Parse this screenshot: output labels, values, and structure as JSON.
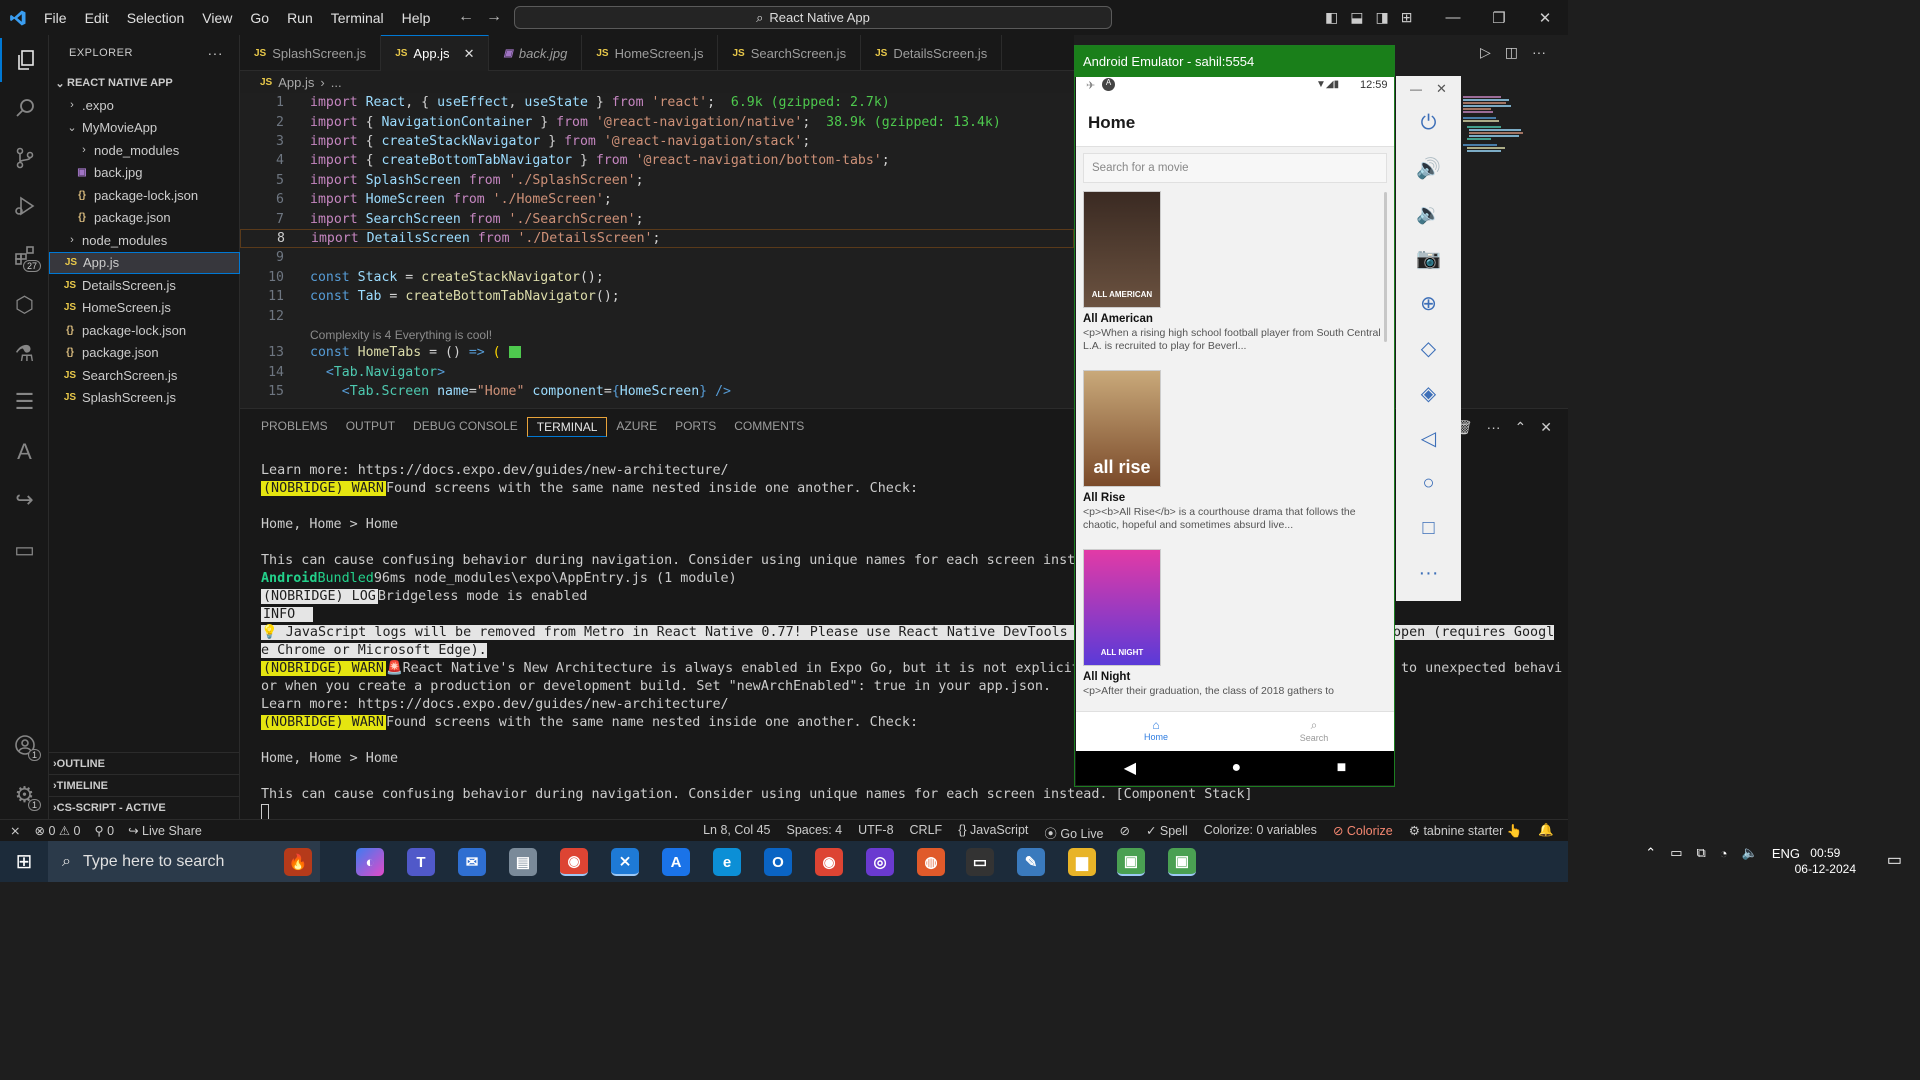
{
  "titlebar": {
    "logo": "⨯",
    "menu": [
      "File",
      "Edit",
      "Selection",
      "View",
      "Go",
      "Run",
      "Terminal",
      "Help"
    ],
    "search": "React Native App"
  },
  "activity_badges": {
    "extensions": "27",
    "accounts": "1",
    "settings": "1"
  },
  "sidebar": {
    "title": "EXPLORER",
    "project": "REACT NATIVE APP",
    "tree": [
      {
        "label": ".expo",
        "type": "folder",
        "indent": 1,
        "open": false
      },
      {
        "label": "MyMovieApp",
        "type": "folder",
        "indent": 1,
        "open": true
      },
      {
        "label": "node_modules",
        "type": "folder",
        "indent": 2,
        "open": false
      },
      {
        "label": "back.jpg",
        "type": "img",
        "indent": 2
      },
      {
        "label": "package-lock.json",
        "type": "json",
        "indent": 2
      },
      {
        "label": "package.json",
        "type": "json",
        "indent": 2
      },
      {
        "label": "node_modules",
        "type": "folder",
        "indent": 1,
        "open": false
      },
      {
        "label": "App.js",
        "type": "js",
        "indent": 1,
        "selected": true
      },
      {
        "label": "DetailsScreen.js",
        "type": "js",
        "indent": 1
      },
      {
        "label": "HomeScreen.js",
        "type": "js",
        "indent": 1
      },
      {
        "label": "package-lock.json",
        "type": "json",
        "indent": 1
      },
      {
        "label": "package.json",
        "type": "json",
        "indent": 1
      },
      {
        "label": "SearchScreen.js",
        "type": "js",
        "indent": 1
      },
      {
        "label": "SplashScreen.js",
        "type": "js",
        "indent": 1
      }
    ],
    "sections": [
      "OUTLINE",
      "TIMELINE",
      "CS-SCRIPT - ACTIVE"
    ]
  },
  "tabs": [
    {
      "label": "SplashScreen.js",
      "icon": "JS"
    },
    {
      "label": "App.js",
      "icon": "JS",
      "active": true
    },
    {
      "label": "back.jpg",
      "icon": "img"
    },
    {
      "label": "HomeScreen.js",
      "icon": "JS"
    },
    {
      "label": "SearchScreen.js",
      "icon": "JS"
    },
    {
      "label": "DetailsScreen.js",
      "icon": "JS"
    }
  ],
  "breadcrumb": {
    "file": "App.js",
    "rest": "..."
  },
  "code": {
    "l1_hint": "6.9k (gzipped: 2.7k)",
    "l2_hint": "38.9k (gzipped: 13.4k)",
    "codelens": "Complexity is 4 Everything is cool!"
  },
  "panel": {
    "tabs": [
      "PROBLEMS",
      "OUTPUT",
      "DEBUG CONSOLE",
      "TERMINAL",
      "AZURE",
      "PORTS",
      "COMMENTS"
    ],
    "active_tab": "TERMINAL"
  },
  "terminal": {
    "l1": "Learn more: https://docs.expo.dev/guides/new-architecture/",
    "warn_tag": "(NOBRIDGE) WARN",
    "log_tag": "(NOBRIDGE) LOG",
    "info_tag": "INFO",
    "found": "Found screens with the same name nested inside one another. Check:",
    "homes": "Home, Home > Home",
    "confusing_cut": "This can cause confusing behavior during navigation. Consider using unique names for each screen instead. [Comp",
    "confusing_full": "This can cause confusing behavior during navigation. Consider using unique names for each screen instead. [Component Stack]",
    "android": "Android",
    "bundled": "Bundled",
    "bundled_rest": "96ms node_modules\\expo\\AppEntry.js (1 module)",
    "bridgeless": "Bridgeless mode is enabled",
    "js_logs_a": "JavaScript logs will be removed from Metro in React Native 0.77! Please use React Native DevTools as your d",
    "js_logs_b": "open (requires Googl",
    "js_logs_c": "e Chrome or Microsoft Edge).",
    "newarch_a": "React Native's New Architecture is always enabled in Expo Go, but it is not explicitly ena",
    "newarch_b": "to unexpected behavi",
    "newarch_c": "or when you create a production or development build. Set \"newArchEnabled\": true in your app.json."
  },
  "statusbar": {
    "errors": "0",
    "warnings": "0",
    "ports": "0",
    "liveshare": "Live Share",
    "position": "Ln 8, Col 45",
    "spaces": "Spaces: 4",
    "encoding": "UTF-8",
    "eol": "CRLF",
    "language": "JavaScript",
    "golive": "Go Live",
    "spell": "Spell",
    "colorize_vars": "Colorize: 0 variables",
    "colorize": "Colorize",
    "tabnine": "tabnine starter"
  },
  "emulator": {
    "title": "Android Emulator - sahil:5554",
    "time": "12:59",
    "app_title": "Home",
    "search_placeholder": "Search for a movie",
    "movies": [
      {
        "title": "All American",
        "desc": "<p>When a rising high school football player from South Central L.A. is recruited to play for Beverl...",
        "poster_text": "ALL AMERICAN",
        "colors": [
          "#3a2a22",
          "#6b5240"
        ]
      },
      {
        "title": "All Rise",
        "desc": "<p><b>All Rise</b> is a courthouse drama that follows the chaotic, hopeful and sometimes absurd live...",
        "poster_text": "all rise",
        "colors": [
          "#c9a97a",
          "#7a4a2a"
        ]
      },
      {
        "title": "All Night",
        "desc": "<p>After their graduation, the class of 2018 gathers to",
        "poster_text": "ALL NIGHT",
        "colors": [
          "#e23aa6",
          "#5a3ad8"
        ]
      }
    ],
    "tab_home": "Home",
    "tab_search": "Search"
  },
  "taskbar": {
    "search": "Type here to search",
    "lang": "ENG",
    "time": "00:59",
    "date": "06-12-2024"
  }
}
